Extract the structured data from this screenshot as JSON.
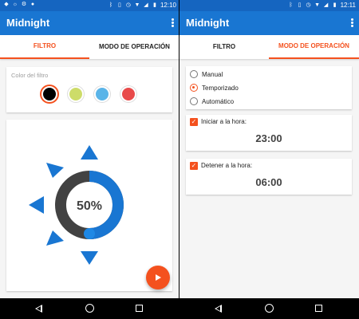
{
  "colors": {
    "statusbar": "#1565c0",
    "appbar": "#1976d2",
    "accent": "#f4511e",
    "dial_blue": "#1976d2",
    "dial_track": "#424242"
  },
  "left": {
    "status": {
      "icons": [
        "android-icon",
        "brightness-icon",
        "settings-icon",
        "messenger-icon"
      ],
      "right_icons": [
        "bluetooth-icon",
        "vibrate-icon",
        "alarm-icon",
        "wifi-icon",
        "signal-icon",
        "battery-icon"
      ],
      "time": "12:10"
    },
    "app_title": "Midnight",
    "tabs": [
      {
        "label": "FILTRO",
        "active": true
      },
      {
        "label": "MODO DE OPERACIÓN",
        "active": false
      }
    ],
    "color_card": {
      "label": "Color del filtro",
      "swatches": [
        {
          "name": "black",
          "color": "#000000",
          "selected": true
        },
        {
          "name": "olive",
          "color": "#cddc69",
          "selected": false
        },
        {
          "name": "light-blue",
          "color": "#5ab4e8",
          "selected": false
        },
        {
          "name": "red",
          "color": "#e84a4a",
          "selected": false
        }
      ]
    },
    "dial": {
      "percent_label": "50%",
      "level": 0.5
    }
  },
  "right": {
    "status": {
      "time": "12:11"
    },
    "app_title": "Midnight",
    "tabs": [
      {
        "label": "FILTRO",
        "active": false
      },
      {
        "label": "MODO DE OPERACIÓN",
        "active": true
      }
    ],
    "modes": [
      {
        "label": "Manual",
        "selected": false
      },
      {
        "label": "Temporizado",
        "selected": true
      },
      {
        "label": "Automático",
        "selected": false
      }
    ],
    "start": {
      "label": "Iniciar a la hora:",
      "time": "23:00",
      "checked": true
    },
    "stop": {
      "label": "Detener a la hora:",
      "time": "06:00",
      "checked": true
    }
  }
}
